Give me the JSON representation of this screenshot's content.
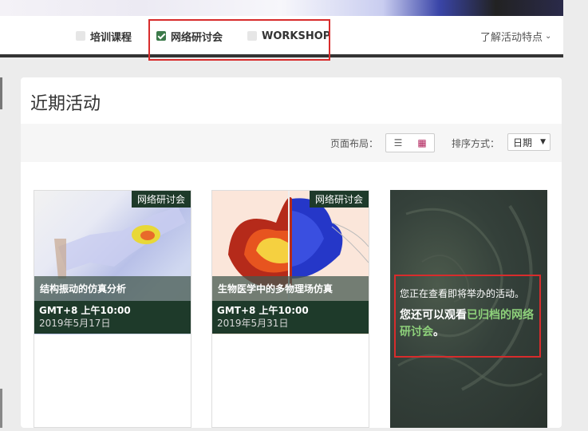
{
  "filters": [
    {
      "label": "培训课程",
      "checked": false
    },
    {
      "label": "网络研讨会",
      "checked": true
    },
    {
      "label": "WORKSHOP",
      "checked": false
    }
  ],
  "features_label": "了解活动特点",
  "panel": {
    "title": "近期活动",
    "layout_label": "页面布局：",
    "sort_label": "排序方式：",
    "sort_value": "日期"
  },
  "cards": [
    {
      "tag": "网络研讨会",
      "title": "结构振动的仿真分析",
      "time": "GMT+8 上午10:00",
      "date": "2019年5月17日"
    },
    {
      "tag": "网络研讨会",
      "title": "生物医学中的多物理场仿真",
      "time": "GMT+8 上午10:00",
      "date": "2019年5月31日"
    }
  ],
  "promo": {
    "line1": "您正在查看即将举办的活动。",
    "line2_prefix": "您还可以观看",
    "line2_link": "已归档的网络研讨会",
    "line2_suffix": "。"
  },
  "colors": {
    "accent_green": "#3c7a4a",
    "tag_bg": "#1e3a2a",
    "highlight_red": "#d82c2c"
  }
}
